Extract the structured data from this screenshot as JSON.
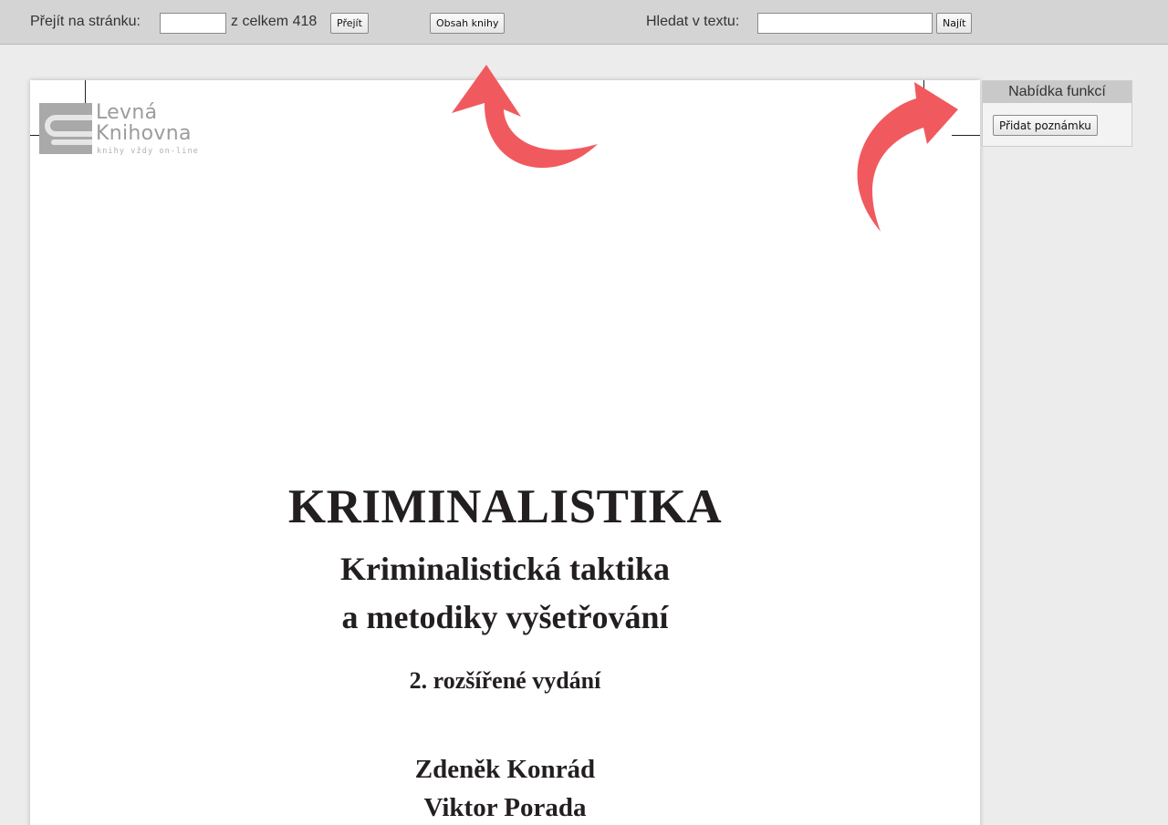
{
  "toolbar": {
    "goto_label": "Přejít na stránku:",
    "goto_value": "",
    "total_label": "z celkem 418",
    "goto_button": "Přejít",
    "toc_button": "Obsah knihy",
    "search_label": "Hledat v textu:",
    "search_value": "",
    "search_button": "Najít"
  },
  "logo": {
    "line1": "Levná",
    "line2": "Knihovna",
    "tagline": "knihy vždy on-line"
  },
  "book": {
    "title": "KRIMINALISTIKA",
    "subtitle_line1": "Kriminalistická taktika",
    "subtitle_line2": "a metodiky vyšetřování",
    "edition": "2. rozšířené vydání",
    "authors": [
      "Zdeněk Konrád",
      "Viktor Porada"
    ]
  },
  "panel": {
    "title": "Nabídka funkcí",
    "add_note_button": "Přidat poznámku"
  },
  "colors": {
    "annotation_arrow": "#f05a5f",
    "toolbar_bg": "#d4d4d4",
    "page_bg": "#ffffff"
  },
  "icons": [
    "curved-arrow-annotation"
  ]
}
